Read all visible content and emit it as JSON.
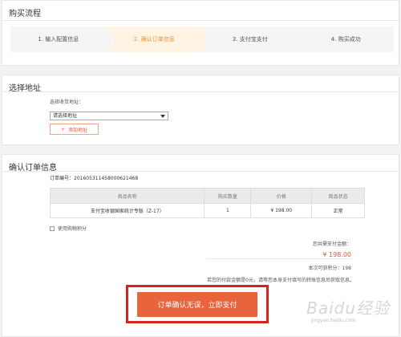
{
  "purchase_flow": {
    "title": "购买流程",
    "steps": [
      {
        "label": "1. 输入配置信息"
      },
      {
        "label": "2. 确认订单信息",
        "active": true
      },
      {
        "label": "3. 支付宝支付"
      },
      {
        "label": "4. 购买成功"
      }
    ]
  },
  "address": {
    "title": "选择地址",
    "select_label": "选择收货地址：",
    "select_value": "请选择地址",
    "add_button": "添加地址",
    "add_icon": "plus-icon"
  },
  "order": {
    "title": "确认订单信息",
    "order_no": "订单编号：2016053114580006214​68",
    "table": {
      "headers": [
        "商品名称",
        "购买数量",
        "价格",
        "商品状态"
      ],
      "rows": [
        [
          "支付宝收银国家统计专版（Z-17）",
          "1",
          "¥ 198.00",
          "正常"
        ]
      ]
    },
    "use_points_label": "使用购物积分",
    "total_label": "您共需支付金额：",
    "total_value": "¥ 198.00",
    "points_earned": "本次可获积分：198",
    "note": "若您的付款金额是0元，请等您本身支付填写的转账信息后获取信息。",
    "submit_button": "订单确认无误，立即支付"
  },
  "watermark": {
    "text": "Baidu经验",
    "sub": "jingyan.baidu.com"
  },
  "colors": {
    "accent": "#f0902c",
    "price": "#e8553e",
    "submit_bg": "#e8643c",
    "highlight_border": "#d6231d"
  }
}
